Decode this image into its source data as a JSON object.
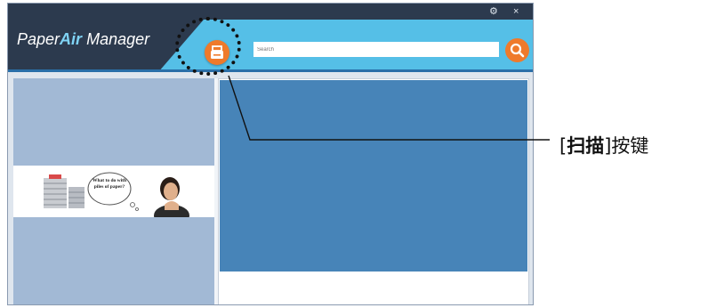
{
  "app": {
    "logo_part1": "Paper",
    "logo_part2": "Air",
    "logo_part3": "Manager"
  },
  "titlebar": {
    "settings_glyph": "⚙",
    "close_glyph": "×"
  },
  "search": {
    "placeholder": "Search"
  },
  "callout": {
    "bracket_open": "[",
    "name": "扫描",
    "bracket_close": "]",
    "suffix": "按键"
  },
  "banner": {
    "thought_text": "What to do with piles of paper?"
  },
  "colors": {
    "header_blue": "#55bfe7",
    "dark_navy": "#2c3a4e",
    "accent_orange": "#ef7a2b",
    "preview_blue": "#4784b8",
    "panel_blue": "#a2b9d5"
  },
  "icons": {
    "scan": "scanner-icon",
    "search": "search-icon",
    "settings": "gear-icon",
    "close": "close-icon"
  }
}
